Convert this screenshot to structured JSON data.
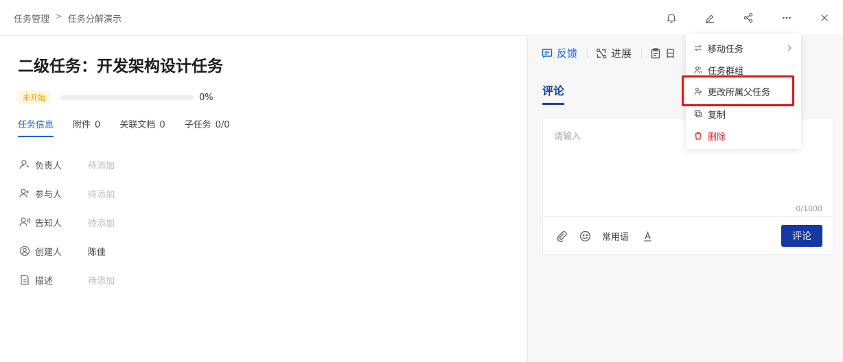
{
  "breadcrumb": {
    "parent": "任务管理",
    "separator": ">",
    "current": "任务分解演示"
  },
  "task": {
    "title": "二级任务：开发架构设计任务",
    "status": "未开始",
    "progress_percent": 0,
    "progress_label": "0%"
  },
  "tabs": [
    {
      "label": "任务信息",
      "count": ""
    },
    {
      "label": "附件",
      "count": "0"
    },
    {
      "label": "关联文档",
      "count": "0"
    },
    {
      "label": "子任务",
      "count": "0/0"
    }
  ],
  "fields": [
    {
      "icon": "user-icon",
      "label": "负责人",
      "value": "待添加"
    },
    {
      "icon": "user-plus-icon",
      "label": "参与人",
      "value": "待添加"
    },
    {
      "icon": "user-notify-icon",
      "label": "告知人",
      "value": "待添加"
    },
    {
      "icon": "user-circle-icon",
      "label": "创建人",
      "value": "陈佳"
    },
    {
      "icon": "document-icon",
      "label": "描述",
      "value": "待添加"
    }
  ],
  "right_tabs": [
    {
      "label": "反馈",
      "icon": "chat-icon"
    },
    {
      "label": "进展",
      "icon": "progress-icon"
    },
    {
      "label": "日",
      "icon": "clipboard-icon"
    }
  ],
  "comment": {
    "tab_label": "评论",
    "placeholder": "请输入",
    "counter": "0/1000",
    "common_phrases": "常用语",
    "submit_label": "评论"
  },
  "menu": {
    "items": [
      {
        "label": "移动任务",
        "icon": "swap-icon",
        "has_submenu": true
      },
      {
        "label": "任务群组",
        "icon": "group-icon"
      },
      {
        "label": "更改所属父任务",
        "icon": "user-switch-icon",
        "highlighted": true
      },
      {
        "label": "复制",
        "icon": "copy-icon"
      },
      {
        "label": "删除",
        "icon": "trash-icon",
        "danger": true
      }
    ]
  },
  "colors": {
    "accent": "#1664d9",
    "primary_button": "#1438a6",
    "danger": "#e02b2b",
    "status_badge": "#f3a100",
    "highlight": "#e01616"
  }
}
